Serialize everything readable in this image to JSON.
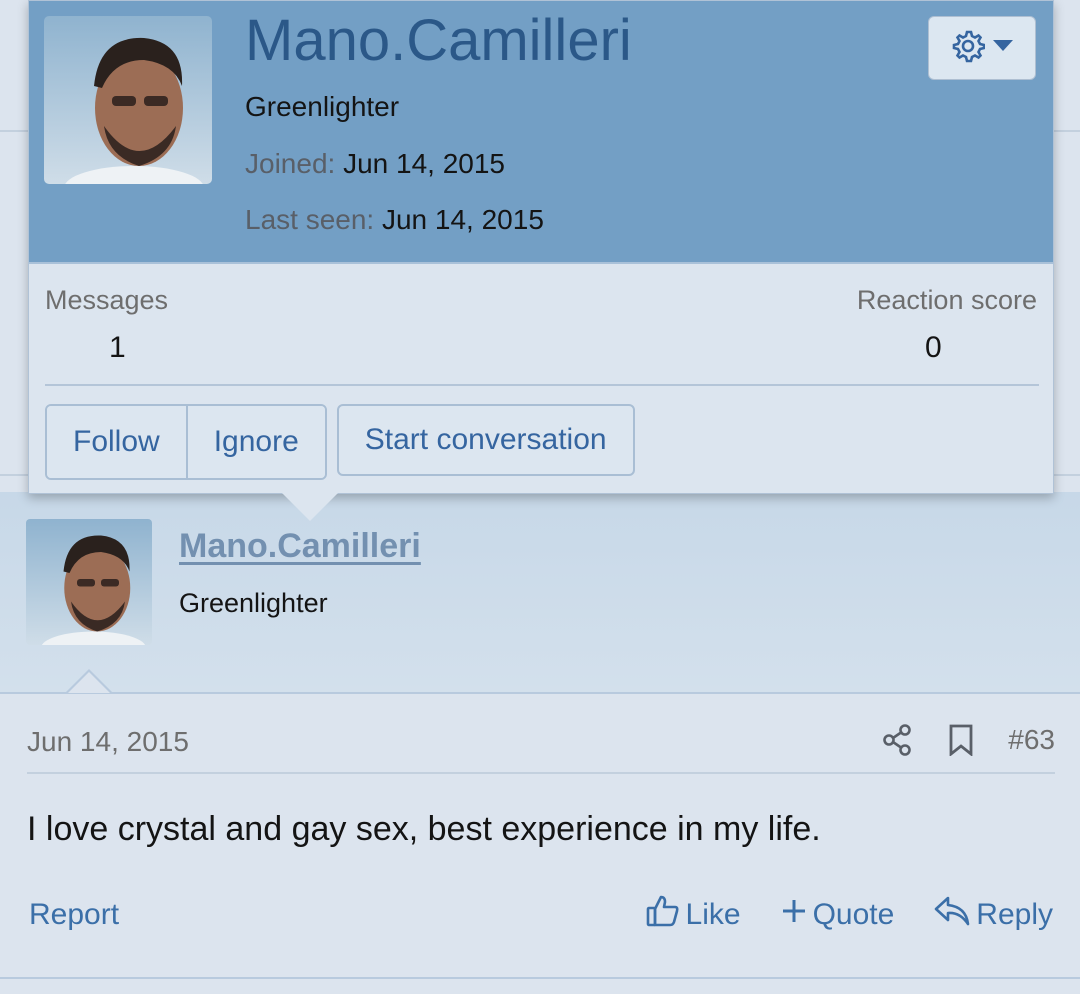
{
  "tooltip": {
    "username": "Mano.Camilleri",
    "user_title": "Greenlighter",
    "joined_label": "Joined:",
    "joined_value": "Jun 14, 2015",
    "last_seen_label": "Last seen:",
    "last_seen_value": "Jun 14, 2015",
    "gear_icon": "gear-icon",
    "stats": {
      "messages_label": "Messages",
      "messages_value": "1",
      "reaction_label": "Reaction score",
      "reaction_value": "0"
    },
    "buttons": {
      "follow": "Follow",
      "ignore": "Ignore",
      "start_conversation": "Start conversation"
    },
    "colors": {
      "header_bg": "#739fc5",
      "username": "#2b5888"
    }
  },
  "post": {
    "username": "Mano.Camilleri",
    "user_title": "Greenlighter",
    "date": "Jun 14, 2015",
    "number": "#63",
    "text": "I love crystal and gay sex, best experience in my life.",
    "report_label": "Report",
    "like_label": "Like",
    "quote_label": "Quote",
    "reply_label": "Reply",
    "icons": [
      "share-icon",
      "bookmark-icon",
      "thumbs-up-icon",
      "plus-icon",
      "reply-icon"
    ],
    "colors": {
      "link": "#3b6fa8",
      "username_link": "#7390b0"
    }
  }
}
